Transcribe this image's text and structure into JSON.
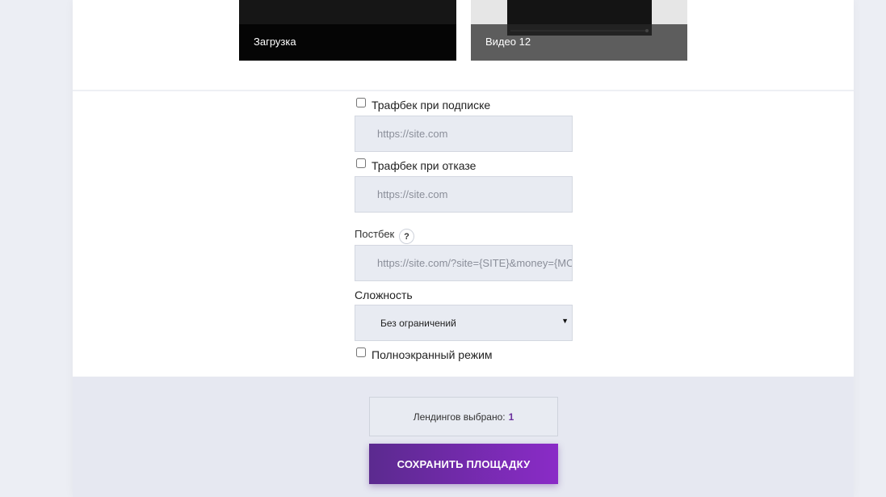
{
  "landings": [
    {
      "label": "Загрузка"
    },
    {
      "label": "Видео 12"
    }
  ],
  "trafback_subscribe": {
    "label": "Трафбек при подписке",
    "checked": false,
    "placeholder": "https://site.com"
  },
  "trafback_decline": {
    "label": "Трафбек при отказе",
    "checked": false,
    "placeholder": "https://site.com"
  },
  "postback": {
    "label": "Постбек",
    "help": "?",
    "placeholder": "https://site.com/?site={SITE}&money={MONEY}"
  },
  "difficulty": {
    "label": "Сложность",
    "selected": "Без ограничений"
  },
  "fullscreen": {
    "label": "Полноэкранный режим",
    "checked": false
  },
  "footer": {
    "selected_label": "Лендингов выбрано:",
    "selected_count": "1",
    "save_label": "СОХРАНИТЬ ПЛОЩАДКУ"
  },
  "colors": {
    "accent_start": "#5b2a8f",
    "accent_end": "#8a2bc7",
    "field_bg": "#e8ebf2",
    "footer_bg": "#e6e8f1"
  },
  "icons": {
    "select_arrow": "chevron-down-icon",
    "help": "help-icon"
  }
}
